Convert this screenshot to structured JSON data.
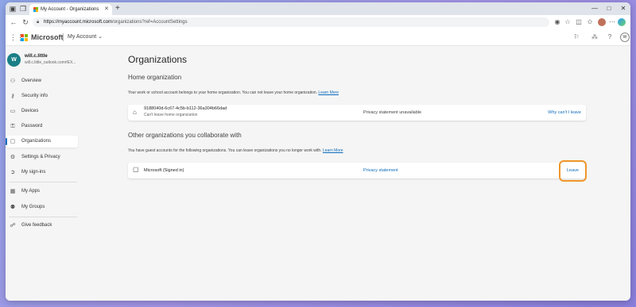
{
  "browser": {
    "tab_title": "My Account - Organizations",
    "url_host": "https://myaccount.microsoft.com",
    "url_path": "/organizations?ref=AccountSettings",
    "new_tab": "+",
    "minimize": "—",
    "maximize": "□",
    "close": "✕"
  },
  "header": {
    "brand": "Microsoft",
    "app_name": "My Account",
    "avatar_initial": "W"
  },
  "user": {
    "initial": "W",
    "name": "will.c.little",
    "email": "will.c.little_outlook.com#EX..."
  },
  "sidebar": {
    "items": [
      {
        "label": "Overview",
        "icon": "person-icon"
      },
      {
        "label": "Security info",
        "icon": "key-person-icon"
      },
      {
        "label": "Devices",
        "icon": "laptop-icon"
      },
      {
        "label": "Password",
        "icon": "key-icon"
      },
      {
        "label": "Organizations",
        "icon": "briefcase-icon",
        "active": true
      },
      {
        "label": "Settings & Privacy",
        "icon": "gear-icon"
      },
      {
        "label": "My sign-ins",
        "icon": "signin-icon"
      },
      {
        "label": "My Apps",
        "icon": "apps-icon"
      },
      {
        "label": "My Groups",
        "icon": "groups-icon"
      },
      {
        "label": "Give feedback",
        "icon": "feedback-icon"
      }
    ]
  },
  "main": {
    "title": "Organizations",
    "home": {
      "heading": "Home organization",
      "description": "Your work or school account belongs to your home organization. You can not leave your home organization.",
      "learn_more": "Learn More",
      "org_id": "9188040d-6c67-4c5b-b112-36a304b66dad",
      "org_sub": "Can't leave home organization",
      "privacy": "Privacy statement unavailable",
      "action": "Why can't I leave"
    },
    "other": {
      "heading": "Other organizations you collaborate with",
      "description": "You have guest accounts for the following organizations. You can leave organizations you no longer work with.",
      "learn_more": "Learn More",
      "org_name": "Microsoft (Signed in)",
      "privacy": "Privacy statement",
      "action": "Leave"
    }
  },
  "colors": {
    "accent": "#0f6cbd",
    "highlight": "#f0962a",
    "avatar": "#1a7f86"
  }
}
